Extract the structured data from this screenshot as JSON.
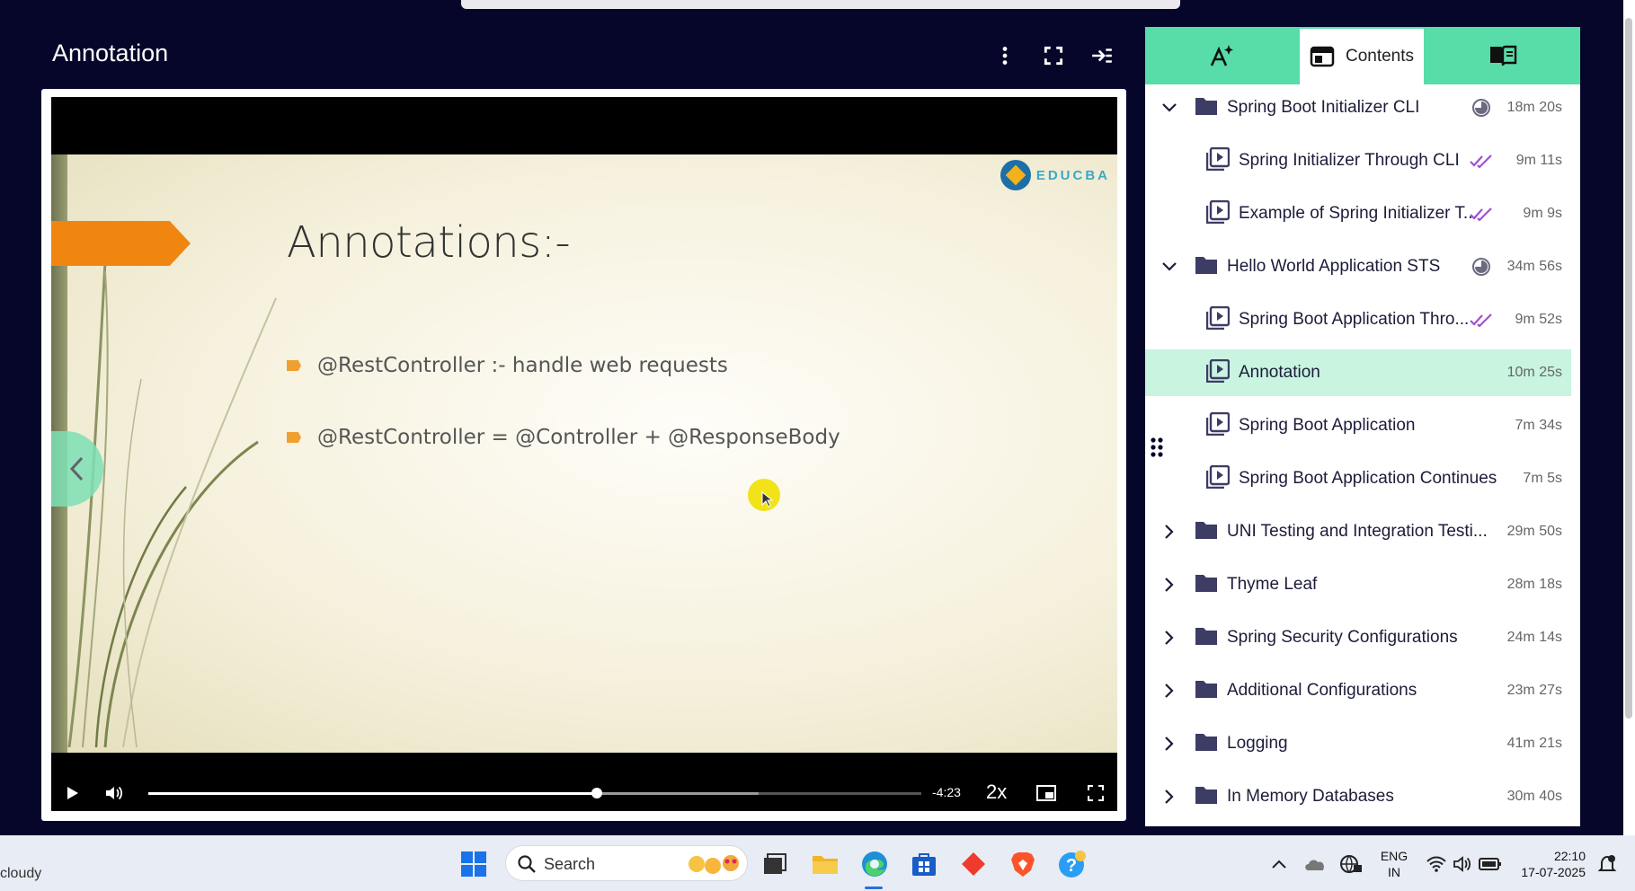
{
  "lesson": {
    "title": "Annotation"
  },
  "slide": {
    "heading": "Annotations:-",
    "bullets": [
      "@RestController :- handle web requests",
      "@RestController = @Controller + @ResponseBody"
    ],
    "logo_text": "EDUCBA"
  },
  "player": {
    "time_remaining": "-4:23",
    "speed": "2x",
    "progress_fraction": 0.58,
    "buffered_fraction": 0.79
  },
  "panel": {
    "tabs": [
      {
        "label": "",
        "icon": "ai-sparkle-icon"
      },
      {
        "label": "Contents",
        "icon": "contents-icon"
      },
      {
        "label": "",
        "icon": "book-icon"
      }
    ],
    "items": [
      {
        "type": "section",
        "label": "Spring Boot Initializer CLI",
        "duration": "18m 20s",
        "expanded": true,
        "status": "partial"
      },
      {
        "type": "lesson",
        "label": "Spring Initializer Through CLI",
        "duration": "9m 11s",
        "status": "done"
      },
      {
        "type": "lesson",
        "label": "Example of Spring Initializer T...",
        "duration": "9m 9s",
        "status": "done"
      },
      {
        "type": "section",
        "label": "Hello World Application STS",
        "duration": "34m 56s",
        "expanded": true,
        "status": "partial"
      },
      {
        "type": "lesson",
        "label": "Spring Boot Application Thro...",
        "duration": "9m 52s",
        "status": "done"
      },
      {
        "type": "lesson",
        "label": "Annotation",
        "duration": "10m 25s",
        "status": "active"
      },
      {
        "type": "lesson",
        "label": "Spring Boot Application",
        "duration": "7m 34s",
        "status": ""
      },
      {
        "type": "lesson",
        "label": "Spring Boot Application Continues",
        "duration": "7m 5s",
        "status": ""
      },
      {
        "type": "section",
        "label": "UNI Testing and Integration Testi...",
        "duration": "29m 50s",
        "expanded": false,
        "status": ""
      },
      {
        "type": "section",
        "label": "Thyme Leaf",
        "duration": "28m 18s",
        "expanded": false,
        "status": ""
      },
      {
        "type": "section",
        "label": "Spring Security Configurations",
        "duration": "24m 14s",
        "expanded": false,
        "status": ""
      },
      {
        "type": "section",
        "label": "Additional Configurations",
        "duration": "23m 27s",
        "expanded": false,
        "status": ""
      },
      {
        "type": "section",
        "label": "Logging",
        "duration": "41m 21s",
        "expanded": false,
        "status": ""
      },
      {
        "type": "section",
        "label": "In Memory Databases",
        "duration": "30m 40s",
        "expanded": false,
        "status": ""
      }
    ]
  },
  "taskbar": {
    "weather": "cloudy",
    "search_placeholder": "Search",
    "language_line1": "ENG",
    "language_line2": "IN",
    "time": "22:10",
    "date": "17-07-2025"
  },
  "colors": {
    "background": "#06062a",
    "accent": "#58dca8",
    "active_row": "#c8f4e0",
    "done_check": "#a24fd6"
  }
}
